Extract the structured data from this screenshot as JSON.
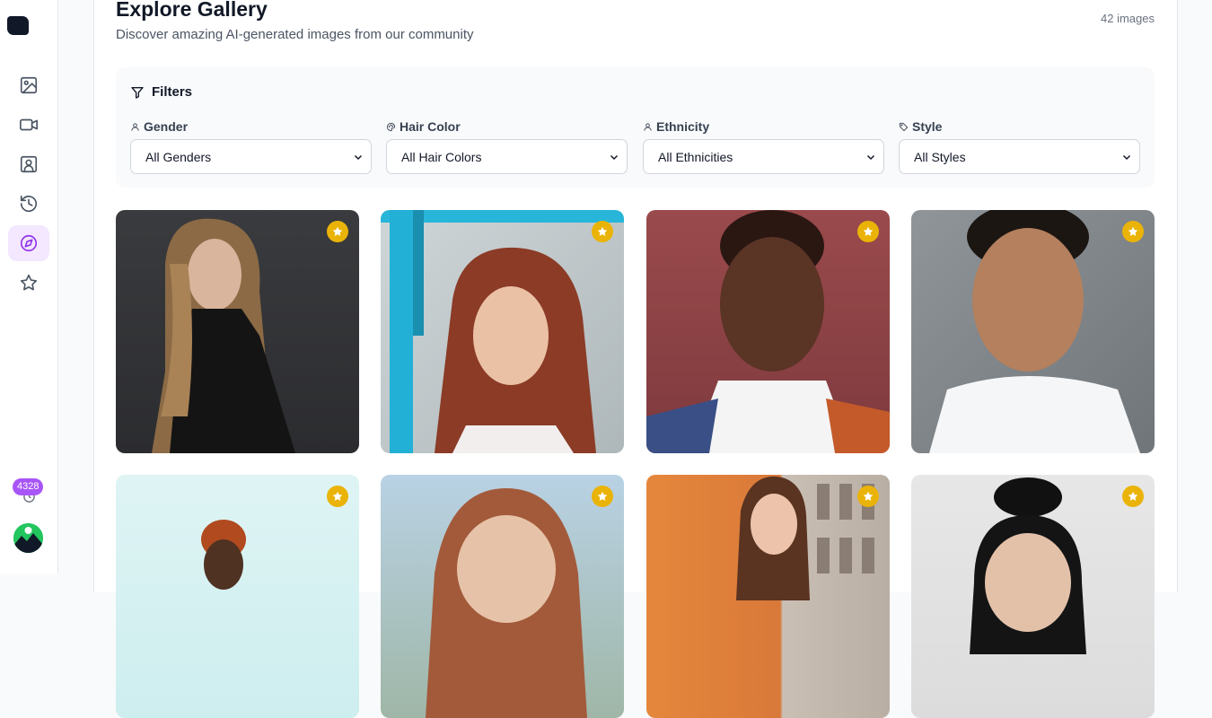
{
  "sidebar": {
    "items": [
      {
        "icon": "image-icon"
      },
      {
        "icon": "video-icon"
      },
      {
        "icon": "portrait-icon"
      },
      {
        "icon": "history-icon"
      },
      {
        "icon": "compass-icon",
        "active": true
      },
      {
        "icon": "star-icon"
      }
    ],
    "credits": "4328"
  },
  "header": {
    "title": "Explore Gallery",
    "subtitle": "Discover amazing AI-generated images from our community",
    "count": "42 images"
  },
  "filters": {
    "title": "Filters",
    "groups": [
      {
        "label": "Gender",
        "icon": "user-icon",
        "value": "All Genders"
      },
      {
        "label": "Hair Color",
        "icon": "palette-icon",
        "value": "All Hair Colors"
      },
      {
        "label": "Ethnicity",
        "icon": "user-icon",
        "value": "All Ethnicities"
      },
      {
        "label": "Style",
        "icon": "tag-icon",
        "value": "All Styles"
      }
    ]
  },
  "gallery": {
    "featured_color": "#eab308",
    "images": [
      {
        "favorite": true
      },
      {
        "favorite": true
      },
      {
        "favorite": true
      },
      {
        "favorite": true
      },
      {
        "favorite": true
      },
      {
        "favorite": true
      },
      {
        "favorite": true
      },
      {
        "favorite": true
      }
    ]
  },
  "colors": {
    "accent": "#9333ea",
    "accent_light": "#f3e8ff",
    "credits_badge": "#a855f7"
  }
}
